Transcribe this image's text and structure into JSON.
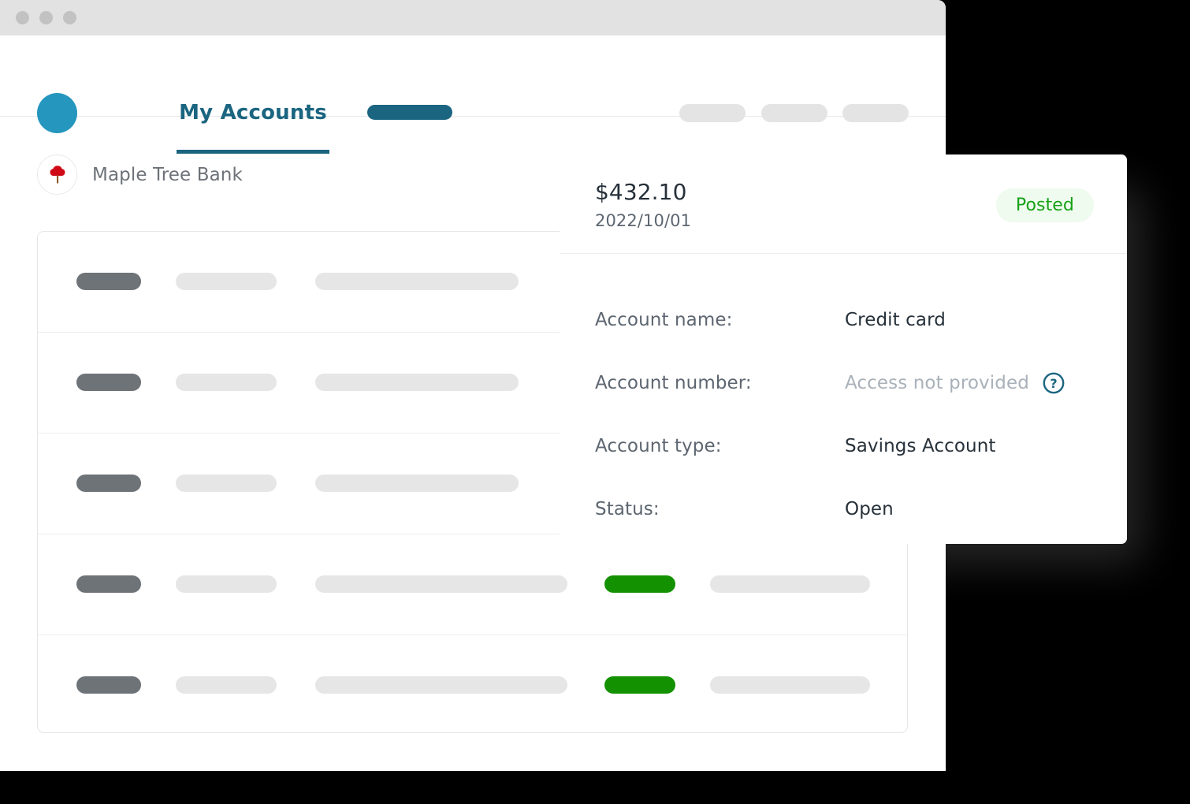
{
  "window": {
    "traffic_lights": [
      "close",
      "minimize",
      "maximize"
    ]
  },
  "topnav": {
    "avatar_color": "#2596be",
    "active_tab": "My Accounts",
    "accent_color": "#1b6580",
    "placeholder_pills": 3
  },
  "bank": {
    "name": "Maple Tree Bank",
    "logo_color": "#cf0a16",
    "trunk_color": "#8a5a28"
  },
  "accounts_panel": {
    "rows": [
      {
        "green_pill": false
      },
      {
        "green_pill": false
      },
      {
        "green_pill": false
      },
      {
        "green_pill": true
      },
      {
        "green_pill": true
      }
    ],
    "skeleton_dark_color": "#6e7378",
    "skeleton_light_color": "#e6e6e6",
    "skeleton_green_color": "#149101"
  },
  "detail_card": {
    "amount": "$432.10",
    "date": "2022/10/01",
    "status_badge": "Posted",
    "status_badge_color": "#16a116",
    "status_badge_bg": "#eefbee",
    "fields": [
      {
        "label": "Account name:",
        "value": "Credit card",
        "muted": false,
        "help": false
      },
      {
        "label": "Account number:",
        "value": "Access not provided",
        "muted": true,
        "help": true
      },
      {
        "label": "Account type:",
        "value": "Savings Account",
        "muted": false,
        "help": false
      },
      {
        "label": "Status:",
        "value": "Open",
        "muted": false,
        "help": false
      }
    ],
    "help_icon_color": "#1b6580",
    "help_icon_glyph": "?"
  }
}
